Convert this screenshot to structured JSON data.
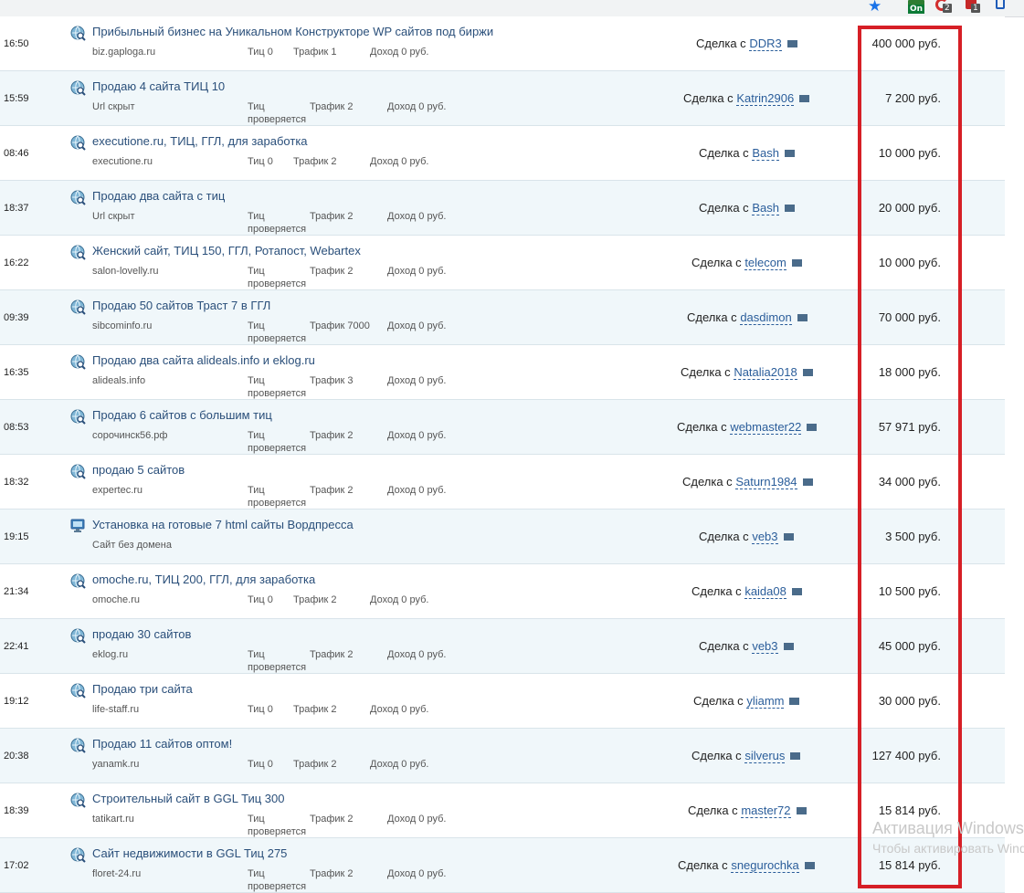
{
  "toolbar": {
    "ext_on_label": "On",
    "ext_c_badge": "2",
    "ext_a_badge": "1"
  },
  "labels": {
    "tic_prefix": "Тиц",
    "traffic_prefix": "Трафик",
    "income_prefix": "Доход",
    "deal_prefix": "Сделка с"
  },
  "rows": [
    {
      "time": "16:50",
      "icon": "search-globe-icon",
      "title": "Прибыльный бизнес на Уникальном Конструкторе WP сайтов под биржи",
      "domain": "biz.gaploga.ru",
      "tic": "Тиц 0",
      "traffic": "Трафик 1",
      "income": "Доход 0 руб.",
      "user": "DDR3",
      "price": "400 000 руб."
    },
    {
      "time": "15:59",
      "icon": "search-globe-icon",
      "title": "Продаю 4 сайта ТИЦ 10",
      "domain": "Url скрыт",
      "tic": "Тиц проверяется",
      "traffic": "Трафик 2",
      "income": "Доход 0 руб.",
      "user": "Katrin2906",
      "price": "7 200 руб."
    },
    {
      "time": "08:46",
      "icon": "search-globe-icon",
      "title": "executione.ru, ТИЦ, ГГЛ, для заработка",
      "domain": "executione.ru",
      "tic": "Тиц 0",
      "traffic": "Трафик 2",
      "income": "Доход 0 руб.",
      "user": "Bash",
      "price": "10 000 руб."
    },
    {
      "time": "18:37",
      "icon": "search-globe-icon",
      "title": "Продаю два сайта с тиц",
      "domain": "Url скрыт",
      "tic": "Тиц проверяется",
      "traffic": "Трафик 2",
      "income": "Доход 0 руб.",
      "user": "Bash",
      "price": "20 000 руб."
    },
    {
      "time": "16:22",
      "icon": "search-globe-icon",
      "title": "Женский сайт, ТИЦ 150, ГГЛ, Ротапост, Webartex",
      "domain": "salon-lovelly.ru",
      "tic": "Тиц проверяется",
      "traffic": "Трафик 2",
      "income": "Доход 0 руб.",
      "user": "telecom",
      "price": "10 000 руб."
    },
    {
      "time": "09:39",
      "icon": "search-globe-icon",
      "title": "Продаю 50 сайтов Траст 7 в ГГЛ",
      "domain": "sibcominfo.ru",
      "tic": "Тиц проверяется",
      "traffic": "Трафик 7000",
      "income": "Доход 0 руб.",
      "user": "dasdimon",
      "price": "70 000 руб."
    },
    {
      "time": "16:35",
      "icon": "search-globe-icon",
      "title": "Продаю два сайта alideals.info и eklog.ru",
      "domain": "alideals.info",
      "tic": "Тиц проверяется",
      "traffic": "Трафик 3",
      "income": "Доход 0 руб.",
      "user": "Natalia2018",
      "price": "18 000 руб."
    },
    {
      "time": "08:53",
      "icon": "search-globe-icon",
      "title": "Продаю 6 сайтов с большим тиц",
      "domain": "сорочинск56.рф",
      "tic": "Тиц проверяется",
      "traffic": "Трафик 2",
      "income": "Доход 0 руб.",
      "user": "webmaster22",
      "price": "57 971 руб."
    },
    {
      "time": "18:32",
      "icon": "search-globe-icon",
      "title": "продаю 5 сайтов",
      "domain": "expertec.ru",
      "tic": "Тиц проверяется",
      "traffic": "Трафик 2",
      "income": "Доход 0 руб.",
      "user": "Saturn1984",
      "price": "34 000 руб."
    },
    {
      "time": "19:15",
      "icon": "monitor-icon",
      "title": "Установка на готовые 7 html сайты Вордпресса",
      "domain": "Сайт без домена",
      "tic": "",
      "traffic": "",
      "income": "",
      "user": "veb3",
      "price": "3 500 руб."
    },
    {
      "time": "21:34",
      "icon": "search-globe-icon",
      "title": "omoche.ru, ТИЦ 200, ГГЛ, для заработка",
      "domain": "omoche.ru",
      "tic": "Тиц 0",
      "traffic": "Трафик 2",
      "income": "Доход 0 руб.",
      "user": "kaida08",
      "price": "10 500 руб."
    },
    {
      "time": "22:41",
      "icon": "search-globe-icon",
      "title": "продаю 30 сайтов",
      "domain": "eklog.ru",
      "tic": "Тиц проверяется",
      "traffic": "Трафик 2",
      "income": "Доход 0 руб.",
      "user": "veb3",
      "price": "45 000 руб."
    },
    {
      "time": "19:12",
      "icon": "search-globe-icon",
      "title": "Продаю три сайта",
      "domain": "life-staff.ru",
      "tic": "Тиц 0",
      "traffic": "Трафик 2",
      "income": "Доход 0 руб.",
      "user": "yliamm",
      "price": "30 000 руб."
    },
    {
      "time": "20:38",
      "icon": "search-globe-icon",
      "title": "Продаю 11 сайтов оптом!",
      "domain": "yanamk.ru",
      "tic": "Тиц 0",
      "traffic": "Трафик 2",
      "income": "Доход 0 руб.",
      "user": "silverus",
      "price": "127 400 руб."
    },
    {
      "time": "18:39",
      "icon": "search-globe-icon",
      "title": "Строительный сайт в GGL Тиц 300",
      "domain": "tatikart.ru",
      "tic": "Тиц проверяется",
      "traffic": "Трафик 2",
      "income": "Доход 0 руб.",
      "user": "master72",
      "price": "15 814 руб."
    },
    {
      "time": "17:02",
      "icon": "search-globe-icon",
      "title": "Сайт недвижимости в GGL Тиц 275",
      "domain": "floret-24.ru",
      "tic": "Тиц проверяется",
      "traffic": "Трафик 2",
      "income": "Доход 0 руб.",
      "user": "snegurochka",
      "price": "15 814 руб."
    }
  ],
  "watermark": {
    "line1": "Активация Windows",
    "line2": "Чтобы активировать Windows"
  },
  "colors": {
    "highlight": "#d61f26",
    "link": "#2a5d9a",
    "title": "#2a4f7a",
    "row_alt": "#f0f7fa"
  }
}
